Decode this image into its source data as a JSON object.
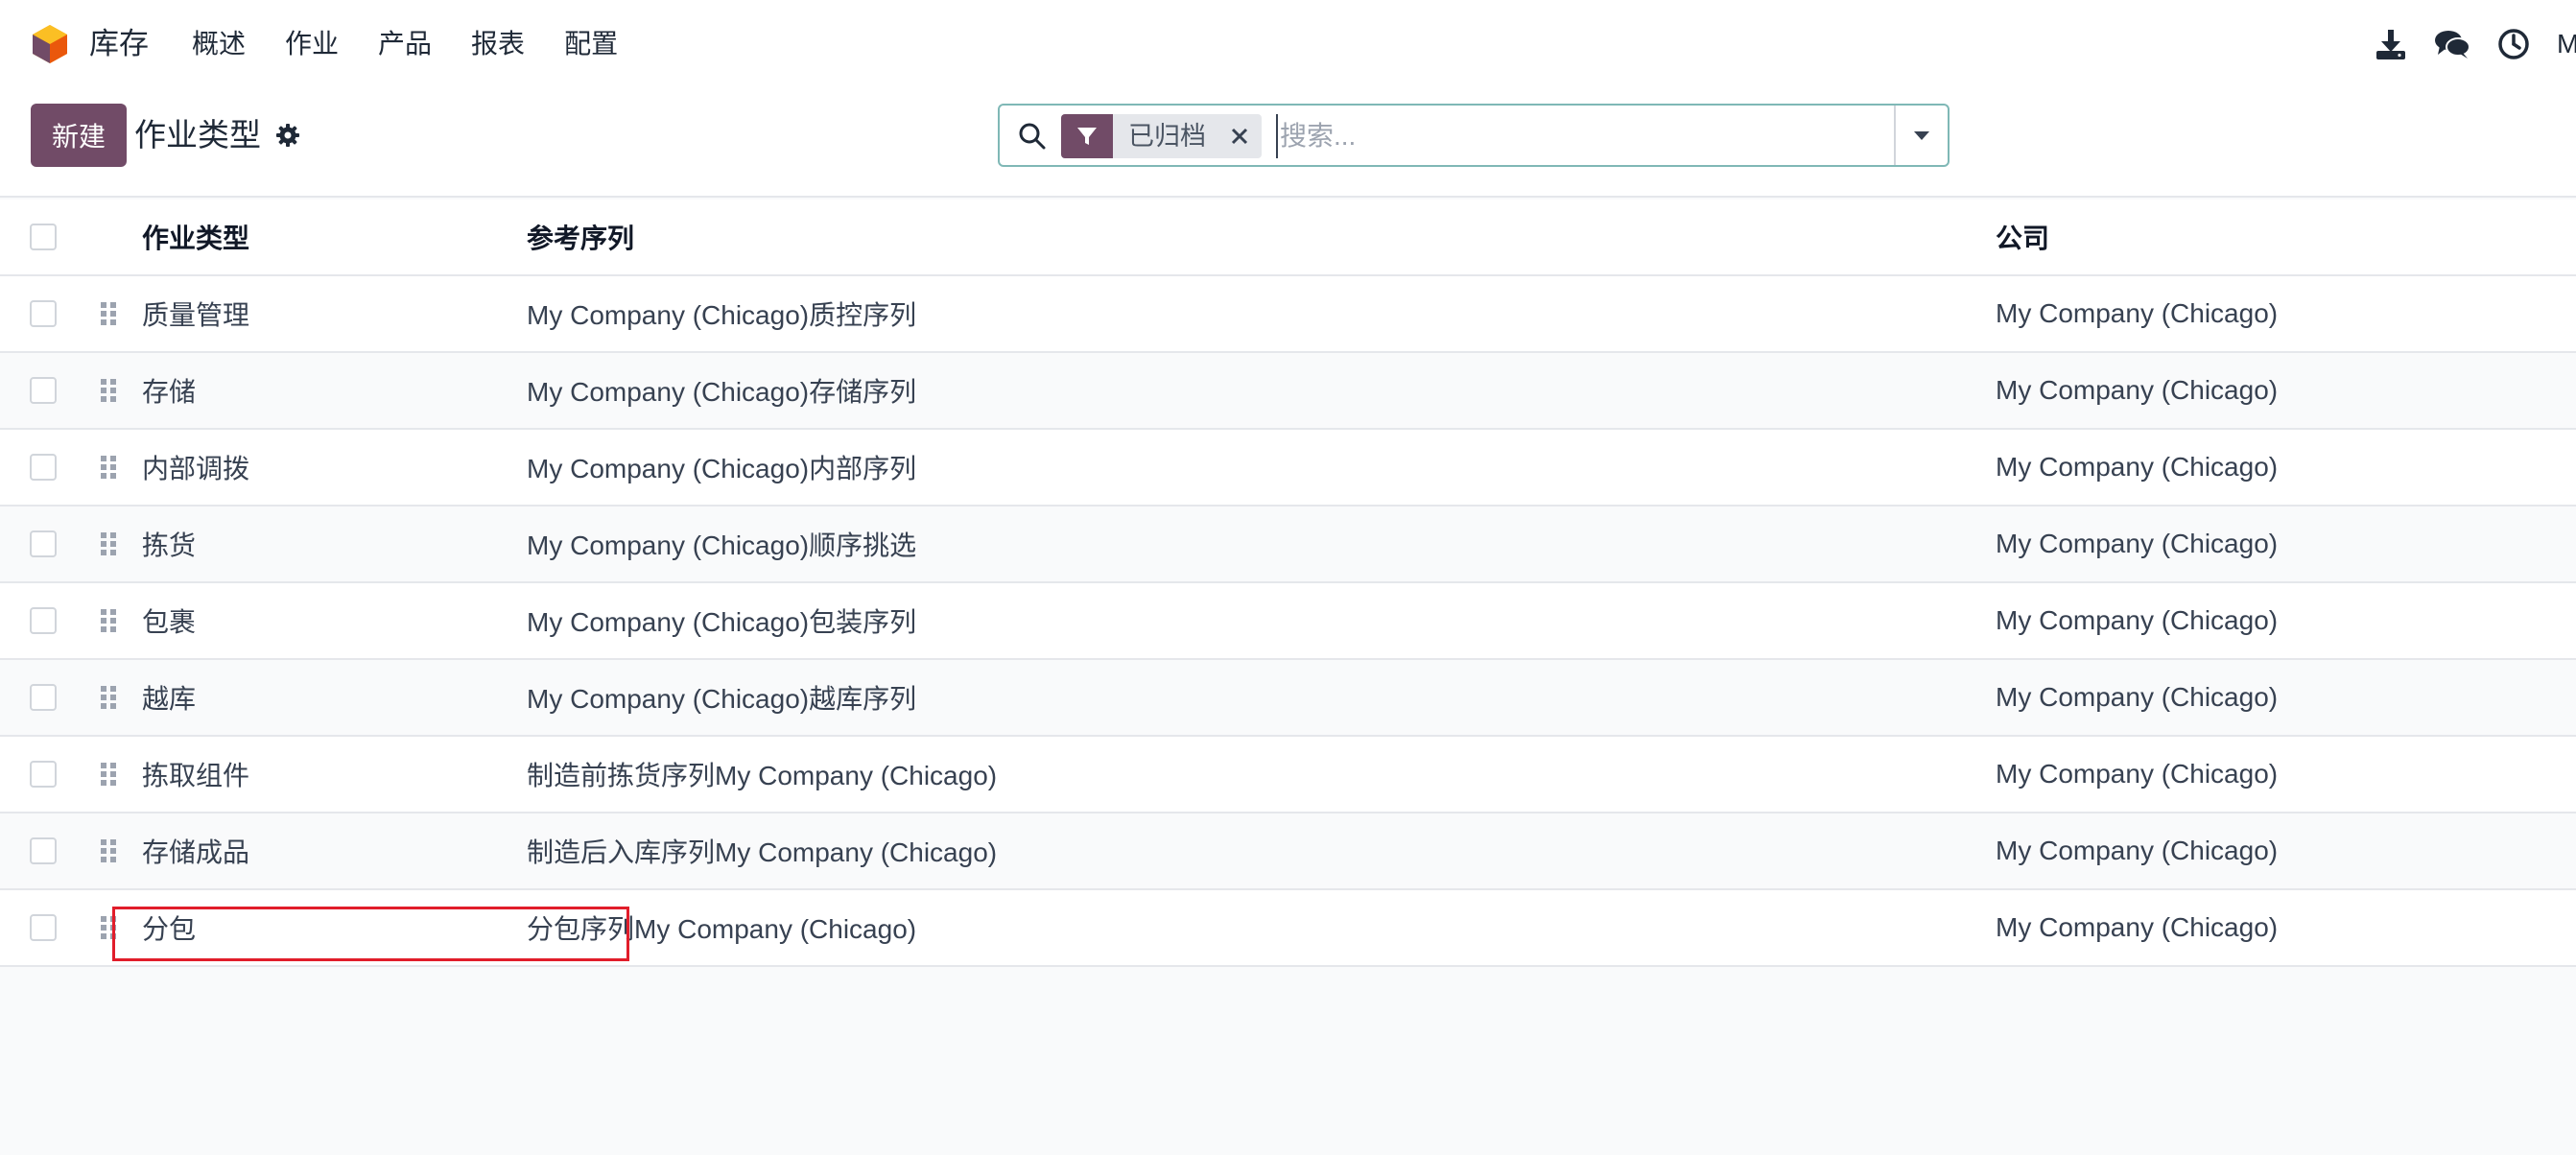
{
  "navbar": {
    "app_name": "库存",
    "menu": [
      "概述",
      "作业",
      "产品",
      "报表",
      "配置"
    ],
    "user_initial": "M",
    "icons": [
      "download-icon",
      "chat-icon",
      "clock-icon"
    ]
  },
  "control_panel": {
    "new_label": "新建",
    "title": "作业类型",
    "search": {
      "facet_label": "已归档",
      "placeholder": "搜索..."
    }
  },
  "table": {
    "headers": {
      "name": "作业类型",
      "sequence": "参考序列",
      "company": "公司"
    },
    "rows": [
      {
        "name": "质量管理",
        "sequence": "My Company (Chicago)质控序列",
        "company": "My Company (Chicago)"
      },
      {
        "name": "存储",
        "sequence": "My Company (Chicago)存储序列",
        "company": "My Company (Chicago)"
      },
      {
        "name": "内部调拨",
        "sequence": "My Company (Chicago)内部序列",
        "company": "My Company (Chicago)"
      },
      {
        "name": "拣货",
        "sequence": "My Company (Chicago)顺序挑选",
        "company": "My Company (Chicago)"
      },
      {
        "name": "包裹",
        "sequence": "My Company (Chicago)包装序列",
        "company": "My Company (Chicago)"
      },
      {
        "name": "越库",
        "sequence": "My Company (Chicago)越库序列",
        "company": "My Company (Chicago)"
      },
      {
        "name": "拣取组件",
        "sequence": "制造前拣货序列My Company (Chicago)",
        "company": "My Company (Chicago)"
      },
      {
        "name": "存储成品",
        "sequence": "制造后入库序列My Company (Chicago)",
        "company": "My Company (Chicago)"
      },
      {
        "name": "分包",
        "sequence": "分包序列My Company (Chicago)",
        "company": "My Company (Chicago)"
      }
    ]
  },
  "colors": {
    "brand": "#714b67",
    "highlight": "#e11d2a",
    "search_border": "#7fb8b6"
  }
}
